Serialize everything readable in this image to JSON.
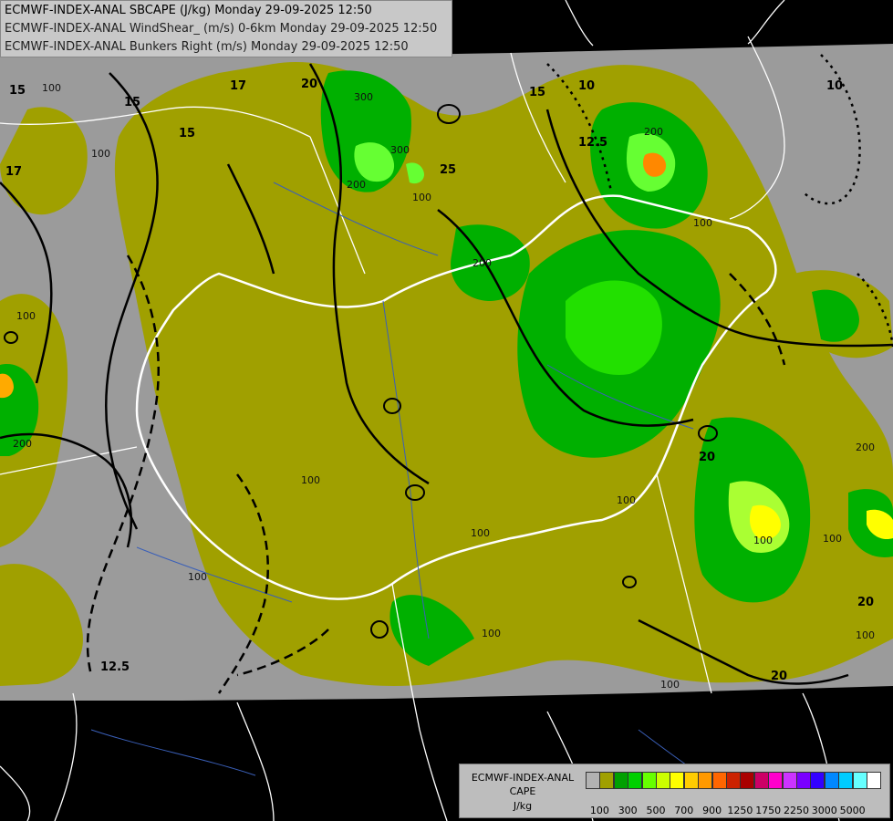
{
  "header": {
    "lines": [
      "ECMWF-INDEX-ANAL SBCAPE (J/kg) Monday 29-09-2025 12:50",
      "ECMWF-INDEX-ANAL WindShear_ (m/s) 0-6km Monday 29-09-2025 12:50",
      "ECMWF-INDEX-ANAL Bunkers Right (m/s) Monday 29-09-2025 12:50"
    ]
  },
  "map": {
    "contour_labels": {
      "shear": [
        "15",
        "15",
        "15",
        "17",
        "17",
        "25",
        "20",
        "12.5",
        "10",
        "15",
        "20",
        "20",
        "12.5",
        "10",
        "20"
      ],
      "cape": [
        "100",
        "100",
        "300",
        "300",
        "200",
        "100",
        "200",
        "100",
        "200",
        "100",
        "100",
        "100",
        "200",
        "100",
        "100",
        "100",
        "100",
        "100",
        "200",
        "100",
        "100"
      ]
    },
    "colors": {
      "background": "#000000",
      "land_low": "#9b9b9b",
      "olive": "#a0a000",
      "green_dark": "#00a000",
      "green": "#00cc00",
      "green_light": "#66ff33",
      "yellow": "#ffff00",
      "orange": "#ff8800",
      "border": "#ffffff"
    }
  },
  "legend": {
    "title_lines": [
      "ECMWF-INDEX-ANAL",
      "CAPE",
      "J/kg"
    ],
    "swatch_colors": [
      "#b2b2b2",
      "#a0a000",
      "#00a000",
      "#00d000",
      "#66ff00",
      "#ccff00",
      "#ffff00",
      "#ffcc00",
      "#ff9900",
      "#ff6600",
      "#cc2200",
      "#aa0000",
      "#cc0066",
      "#ff00cc",
      "#cc33ff",
      "#7a00ff",
      "#3300ff",
      "#0088ff",
      "#00ccff",
      "#66ffff",
      "#ffffff"
    ],
    "tick_labels": [
      "100",
      "300",
      "500",
      "700",
      "900",
      "1250",
      "1750",
      "2250",
      "3000",
      "5000"
    ]
  }
}
